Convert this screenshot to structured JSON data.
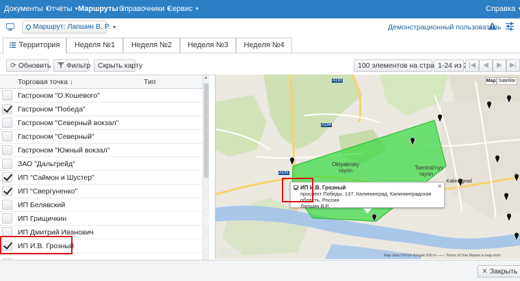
{
  "nav": {
    "items": [
      {
        "label": "Документы",
        "active": false
      },
      {
        "label": "Отчёты",
        "active": false
      },
      {
        "label": "Маршруты",
        "active": true
      },
      {
        "label": "Справочники",
        "active": false
      },
      {
        "label": "Сервис",
        "active": false
      }
    ],
    "help": "Справка"
  },
  "subheader": {
    "route": "Маршрут: Лапшин В. Р.",
    "user": "Демонстрационный пользователь"
  },
  "tabs": [
    {
      "label": "Территория",
      "active": true,
      "icon": "list-icon"
    },
    {
      "label": "Неделя №1",
      "active": false
    },
    {
      "label": "Неделя №2",
      "active": false
    },
    {
      "label": "Неделя №3",
      "active": false
    },
    {
      "label": "Неделя №4",
      "active": false
    }
  ],
  "toolbar": {
    "refresh": "Обновить",
    "filter": "Фильтр",
    "hide_map": "Скрыть карту",
    "per_page": "100 элементов на странице",
    "range": "1-24 из 24"
  },
  "table": {
    "columns": [
      "Торговая точка",
      "Тип"
    ],
    "rows": [
      {
        "name": "Гастроном \"О.Кошевого\"",
        "checked": false
      },
      {
        "name": "Гастроном \"Победа\"",
        "checked": true
      },
      {
        "name": "Гастроном \"Северный вокзал\"",
        "checked": false
      },
      {
        "name": "Гастроном \"Северный\"",
        "checked": false
      },
      {
        "name": "Гастроном \"Южный вокзал\"",
        "checked": false
      },
      {
        "name": "ЗАО \"Дальтрейд\"",
        "checked": false
      },
      {
        "name": "ИП \"Саймон и Шустер\"",
        "checked": true
      },
      {
        "name": "ИП \"Свергуненко\"",
        "checked": true
      },
      {
        "name": "ИП Белявский",
        "checked": false
      },
      {
        "name": "ИП Грищичкин",
        "checked": false
      },
      {
        "name": "ИП Дмитрий Иванович",
        "checked": false
      },
      {
        "name": "ИП И.В. Грозный",
        "checked": true
      }
    ]
  },
  "map": {
    "map_btn": "Map",
    "satellite_btn": "Satellite",
    "popup": {
      "title": "ИП И.В. Грозный",
      "address": "проспект Победы, 137, Калининград, Калининградская область, Россия",
      "person": "Лапшин В.Р."
    },
    "labels": {
      "oktyabrsky": "Oktyabrsky",
      "oktyabrsky2": "rayon",
      "tsentralny": "Tsentral'nyy",
      "tsentralny2": "rayon",
      "kaliningrad": "Kaliningrad",
      "a193": "A193",
      "a194": "A194",
      "a191": "A191"
    },
    "attribution": "Map data ©2014 Google   500 m ——   Terms of Use   Report a map error",
    "google": "Google"
  },
  "footer": {
    "close": "Закрыть"
  }
}
